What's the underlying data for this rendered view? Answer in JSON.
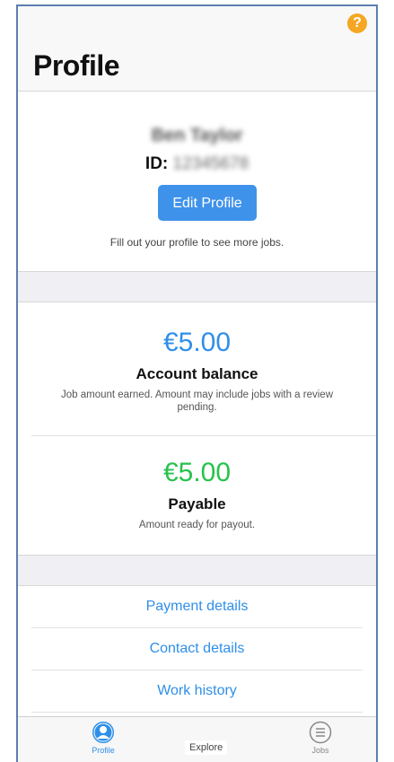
{
  "header": {
    "title": "Profile",
    "help_glyph": "?"
  },
  "profile": {
    "name": "Ben Taylor",
    "id_label": "ID:",
    "id_value": "12345678",
    "edit_button": "Edit Profile",
    "hint": "Fill out your profile to see more jobs."
  },
  "balance": {
    "amount": "€5.00",
    "label": "Account balance",
    "description": "Job amount earned. Amount may include jobs with a review pending."
  },
  "payable": {
    "amount": "€5.00",
    "label": "Payable",
    "description": "Amount ready for payout."
  },
  "links": [
    {
      "label": "Payment details"
    },
    {
      "label": "Contact details"
    },
    {
      "label": "Work history"
    }
  ],
  "tabbar": {
    "profile": "Profile",
    "explore": "Explore",
    "jobs": "Jobs"
  },
  "colors": {
    "accent": "#2f8fe8",
    "payable": "#27c24c",
    "help": "#f5a623"
  }
}
